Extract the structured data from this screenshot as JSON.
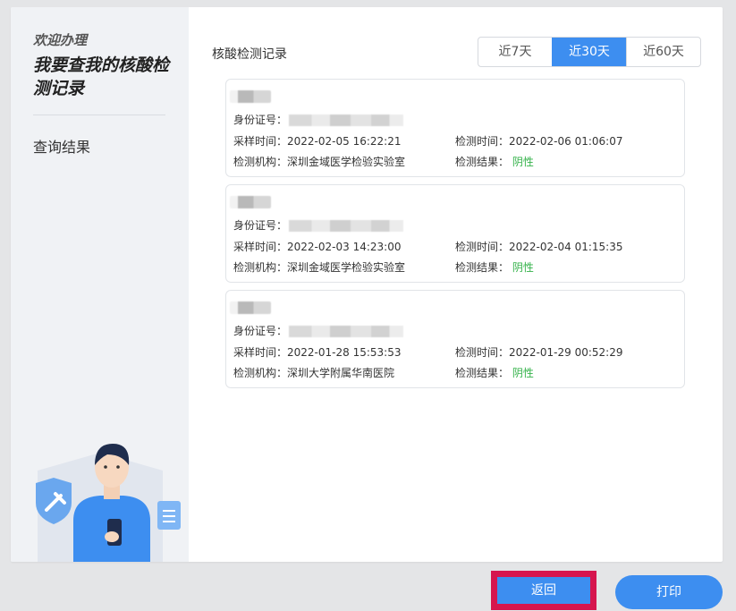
{
  "sidebar": {
    "welcome": "欢迎办理",
    "headline": "我要查我的核酸检测记录",
    "item": "查询结果"
  },
  "main": {
    "title": "核酸检测记录",
    "tabs": [
      {
        "label": "近7天",
        "active": false
      },
      {
        "label": "近30天",
        "active": true
      },
      {
        "label": "近60天",
        "active": false
      }
    ]
  },
  "labels": {
    "id": "身份证号：",
    "sample_time": "采样时间：",
    "test_time": "检测时间：",
    "org": "检测机构：",
    "result": "检测结果："
  },
  "records": [
    {
      "sample_time": "2022-02-05 16:22:21",
      "test_time": "2022-02-06 01:06:07",
      "org": "深圳金域医学检验实验室",
      "result": "阴性"
    },
    {
      "sample_time": "2022-02-03 14:23:00",
      "test_time": "2022-02-04 01:15:35",
      "org": "深圳金域医学检验实验室",
      "result": "阴性"
    },
    {
      "sample_time": "2022-01-28 15:53:53",
      "test_time": "2022-01-29 00:52:29",
      "org": "深圳大学附属华南医院",
      "result": "阴性"
    }
  ],
  "buttons": {
    "back": "返回",
    "print": "打印"
  },
  "colors": {
    "accent": "#3d8ef0",
    "negative": "#34b24a",
    "highlight": "#d6154e"
  }
}
